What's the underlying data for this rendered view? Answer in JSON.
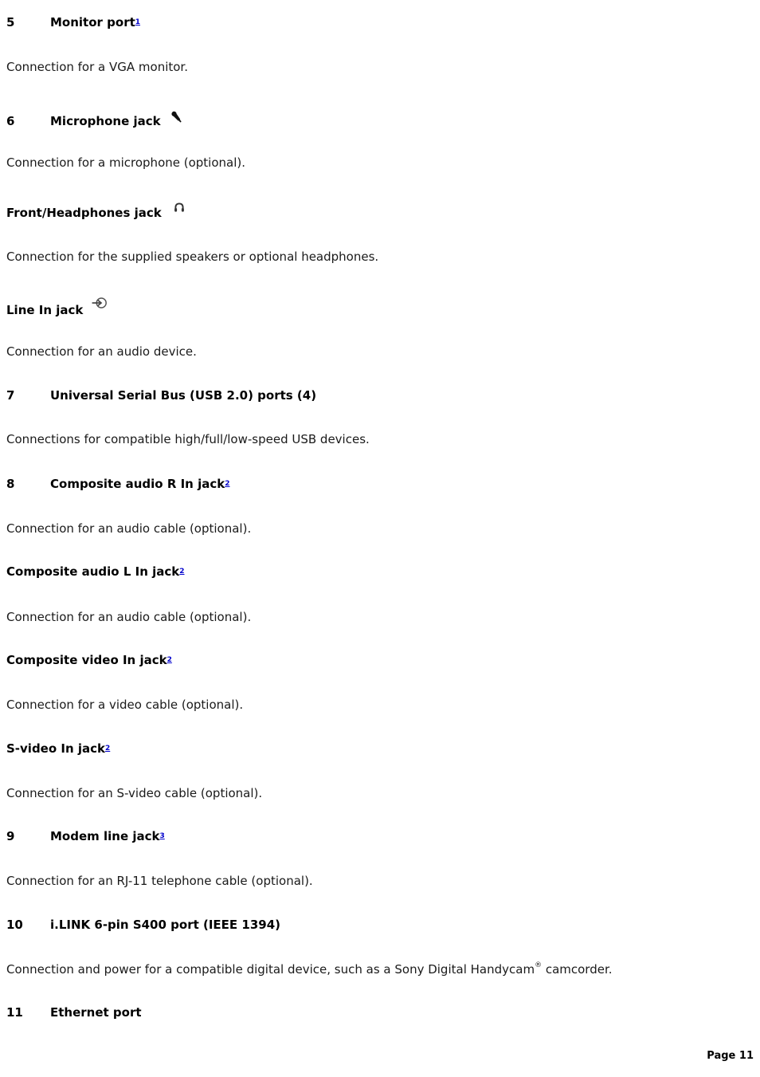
{
  "document": {
    "page_label": "Page 11",
    "entries": [
      {
        "number": "5",
        "label": "Monitor port",
        "footnote": "1",
        "icon": null,
        "description": "Connection for a VGA monitor."
      },
      {
        "number": "6",
        "label": "Microphone jack",
        "footnote": null,
        "icon": "microphone-icon",
        "description": "Connection for a microphone (optional)."
      },
      {
        "number": "",
        "label": "Front/Headphones jack",
        "footnote": null,
        "icon": "headphones-icon",
        "description": "Connection for the supplied speakers or optional headphones."
      },
      {
        "number": "",
        "label": "Line In jack",
        "footnote": null,
        "icon": "line-in-icon",
        "description": "Connection for an audio device."
      },
      {
        "number": "7",
        "label": "Universal Serial Bus (USB 2.0) ports (4)",
        "footnote": null,
        "icon": null,
        "description": "Connections for compatible high/full/low-speed USB devices."
      },
      {
        "number": "8",
        "label": "Composite audio R In jack",
        "footnote": "2",
        "icon": null,
        "description": "Connection for an audio cable (optional)."
      },
      {
        "number": "",
        "label": "Composite audio L In jack",
        "footnote": "2",
        "icon": null,
        "description": "Connection for an audio cable (optional)."
      },
      {
        "number": "",
        "label": "Composite video In jack",
        "footnote": "2",
        "icon": null,
        "description": "Connection for a video cable (optional)."
      },
      {
        "number": "",
        "label": "S-video In jack",
        "footnote": "2",
        "icon": null,
        "description": "Connection for an S-video cable (optional)."
      },
      {
        "number": "9",
        "label": "Modem line jack",
        "footnote": "3",
        "icon": null,
        "description": "Connection for an RJ-11 telephone cable (optional)."
      },
      {
        "number": "10",
        "label": "i.LINK 6-pin S400 port (IEEE 1394)",
        "footnote": null,
        "icon": null,
        "description_pre": "Connection and power for a compatible digital device, such as a Sony Digital Handycam",
        "description_reg": "®",
        "description_post": " camcorder."
      },
      {
        "number": "11",
        "label": "Ethernet port",
        "footnote": null,
        "icon": null,
        "description": null
      }
    ]
  },
  "colors": {
    "link": "#0000cc",
    "text": "#1a1a1a",
    "heading": "#000000",
    "background": "#ffffff"
  }
}
